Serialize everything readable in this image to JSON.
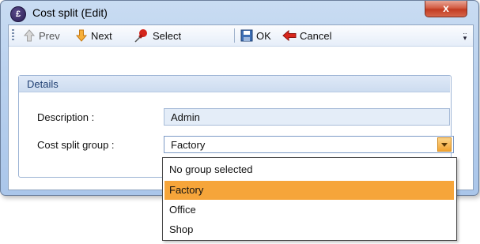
{
  "window": {
    "title": "Cost split (Edit)",
    "app_icon": "pound-sign-icon",
    "close_label": "x"
  },
  "toolbar": {
    "prev_label": "Prev",
    "next_label": "Next",
    "select_label": "Select",
    "ok_label": "OK",
    "cancel_label": "Cancel",
    "icons": {
      "prev": "up-arrow-icon",
      "next": "down-arrow-icon",
      "select": "pin-icon",
      "ok": "save-icon",
      "cancel": "back-arrow-icon"
    }
  },
  "details": {
    "group_title": "Details",
    "description_label": "Description :",
    "description_value": "Admin",
    "cost_split_group_label": "Cost split group :",
    "cost_split_group_value": "Factory"
  },
  "dropdown": {
    "options": [
      "No group selected",
      "Factory",
      "Office",
      "Shop"
    ],
    "selected": "Factory"
  },
  "colors": {
    "selection": "#f6a53a",
    "group_title": "#1f3f72",
    "close_button": "#c23c22"
  }
}
